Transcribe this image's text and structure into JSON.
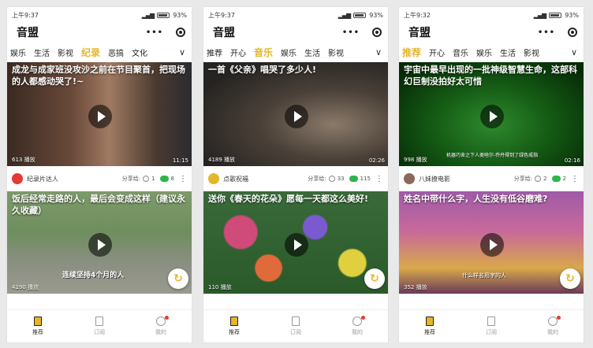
{
  "screens": [
    {
      "time": "上午9:37",
      "battery": "93%",
      "app_title": "音盟",
      "tabs": [
        "娱乐",
        "生活",
        "影视",
        "纪录",
        "恶搞",
        "文化"
      ],
      "active_tab": 3,
      "cards": [
        {
          "title": "成龙与成家班没攻沙之前在节目聚首，把现场的人都感动哭了!~",
          "plays": "613 播放",
          "duration": "11:15",
          "caption": "",
          "author": "纪录片达人",
          "share_label": "分享给:",
          "share_count": "1",
          "wechat_count": "8"
        },
        {
          "title": "饭后经常走路的人，最后会变成这样（建议永久收藏）",
          "plays": "4190 播放",
          "duration": "",
          "caption": "连续坚持4个月的人"
        }
      ]
    },
    {
      "time": "上午9:37",
      "battery": "93%",
      "app_title": "音盟",
      "tabs": [
        "推荐",
        "开心",
        "音乐",
        "娱乐",
        "生活",
        "影视"
      ],
      "active_tab": 2,
      "cards": [
        {
          "title": "一首《父亲》唱哭了多少人!",
          "plays": "4189 播放",
          "duration": "02:26",
          "caption": "",
          "author": "点歌祝福",
          "share_label": "分享给:",
          "share_count": "33",
          "wechat_count": "115"
        },
        {
          "title": "送你《春天的花朵》愿每一天都这么美好!",
          "plays": "110 播放",
          "duration": "",
          "caption": ""
        }
      ]
    },
    {
      "time": "上午9:32",
      "battery": "93%",
      "app_title": "音盟",
      "tabs": [
        "推荐",
        "开心",
        "音乐",
        "娱乐",
        "生活",
        "影视"
      ],
      "active_tab": 0,
      "cards": [
        {
          "title": "宇宙中最早出现的一批神级智慧生命，这部科幻巨制没拍好太可惜",
          "plays": "998 播放",
          "duration": "02:16",
          "caption": "机器巧舍之下人类啥尔-乔丹得到了绿色戒指",
          "author": "八妹撩电影",
          "share_label": "分享给:",
          "share_count": "2",
          "wechat_count": "2"
        },
        {
          "title": "姓名中带什么字，人生没有低谷磨难?",
          "plays": "352 播放",
          "duration": "",
          "caption": "什么样名用字的人"
        }
      ]
    }
  ],
  "tabbar": {
    "items": [
      "推荐",
      "订阅",
      "我的"
    ]
  },
  "colors": {
    "accent": "#e5b52a",
    "wechat": "#2db54a",
    "badge": "#e53935"
  }
}
